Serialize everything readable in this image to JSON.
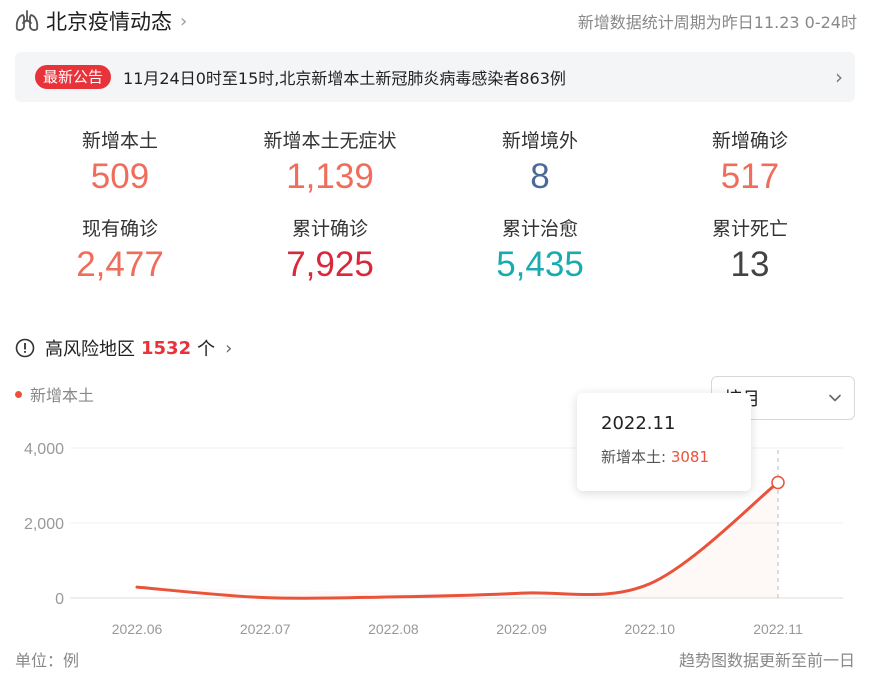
{
  "header": {
    "title": "北京疫情动态",
    "period": "新增数据统计周期为昨日11.23 0-24时"
  },
  "notice": {
    "badge": "最新公告",
    "text": "11月24日0时至15时,北京新增本土新冠肺炎病毒感染者863例"
  },
  "stats": [
    {
      "label": "新增本土",
      "value": "509",
      "color": "#f06c5b"
    },
    {
      "label": "新增本土无症状",
      "value": "1,139",
      "color": "#f06c5b"
    },
    {
      "label": "新增境外",
      "value": "8",
      "color": "#4a6a9a"
    },
    {
      "label": "新增确诊",
      "value": "517",
      "color": "#f06c5b"
    },
    {
      "label": "现有确诊",
      "value": "2,477",
      "color": "#f06c5b"
    },
    {
      "label": "累计确诊",
      "value": "7,925",
      "color": "#d8283a"
    },
    {
      "label": "累计治愈",
      "value": "5,435",
      "color": "#1aabb0"
    },
    {
      "label": "累计死亡",
      "value": "13",
      "color": "#444444"
    }
  ],
  "risk": {
    "label": "高风险地区",
    "count": "1532",
    "unit": "个"
  },
  "legend": {
    "label": "新增本土"
  },
  "select": {
    "value": "按月"
  },
  "tooltip": {
    "title": "2022.11",
    "series": "新增本土:",
    "value": "3081"
  },
  "chart_data": {
    "type": "line",
    "x": [
      "2022.06",
      "2022.07",
      "2022.08",
      "2022.09",
      "2022.10",
      "2022.11"
    ],
    "series": [
      {
        "name": "新增本土",
        "values": [
          290,
          10,
          30,
          130,
          380,
          3081
        ],
        "color": "#e8533a"
      }
    ],
    "yticks": [
      "4,000",
      "2,000",
      "0"
    ],
    "ylim": [
      0,
      4000
    ],
    "highlight": "2022.11"
  },
  "footer": {
    "unit": "单位：例",
    "note": "趋势图数据更新至前一日"
  }
}
